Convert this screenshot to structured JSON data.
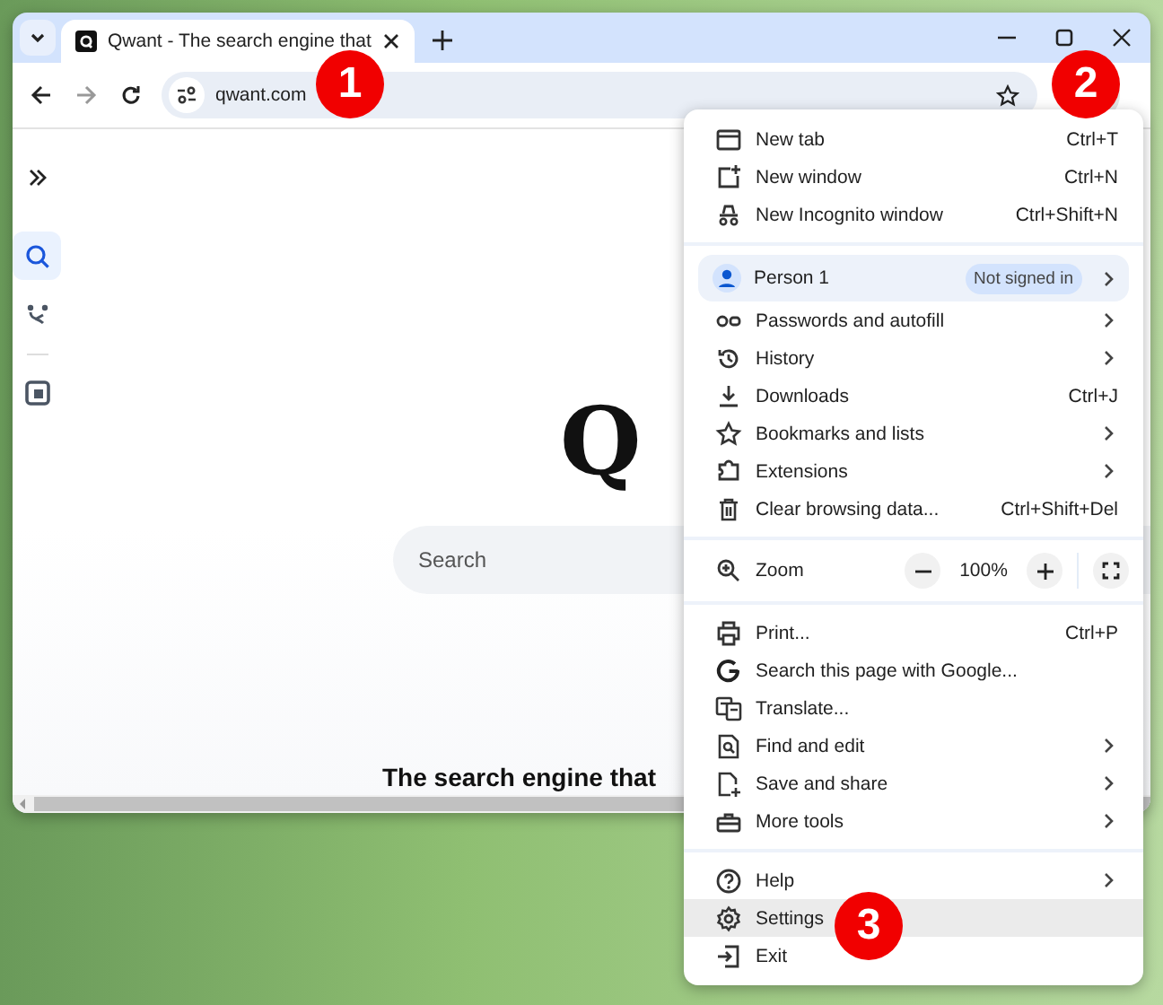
{
  "window": {
    "tabs": [
      {
        "title": "Qwant - The search engine that",
        "selected": true
      }
    ]
  },
  "toolbar": {
    "url": "qwant.com",
    "menu_open": true
  },
  "sidebar": {
    "items": [
      {
        "selected": true
      },
      {
        "selected": false
      },
      {
        "selected": false
      }
    ]
  },
  "page": {
    "logo": "Q",
    "search": {
      "placeholder": "Search"
    },
    "tagline": "The search engine that"
  },
  "menu": {
    "groups": [
      [
        {
          "kind": "item",
          "label": "New tab",
          "shortcut": "Ctrl+T",
          "submenu": false,
          "highlighted": false
        },
        {
          "kind": "item",
          "label": "New window",
          "shortcut": "Ctrl+N",
          "submenu": false,
          "highlighted": false
        },
        {
          "kind": "item",
          "label": "New Incognito window",
          "shortcut": "Ctrl+Shift+N",
          "submenu": false,
          "highlighted": false
        }
      ],
      [
        {
          "kind": "profile",
          "label": "Person 1",
          "status": "Not signed in",
          "submenu": true,
          "highlighted": false
        },
        {
          "kind": "item",
          "label": "Passwords and autofill",
          "submenu": true,
          "highlighted": false
        },
        {
          "kind": "item",
          "label": "History",
          "submenu": true,
          "highlighted": false
        },
        {
          "kind": "item",
          "label": "Downloads",
          "shortcut": "Ctrl+J",
          "submenu": false,
          "highlighted": false
        },
        {
          "kind": "item",
          "label": "Bookmarks and lists",
          "submenu": true,
          "highlighted": false
        },
        {
          "kind": "item",
          "label": "Extensions",
          "submenu": true,
          "highlighted": false
        },
        {
          "kind": "item",
          "label": "Clear browsing data...",
          "shortcut": "Ctrl+Shift+Del",
          "submenu": false,
          "highlighted": false
        }
      ],
      [
        {
          "kind": "zoom",
          "label": "Zoom",
          "value": "100%"
        }
      ],
      [
        {
          "kind": "item",
          "label": "Print...",
          "shortcut": "Ctrl+P",
          "submenu": false,
          "highlighted": false
        },
        {
          "kind": "item",
          "label": "Search this page with Google...",
          "submenu": false,
          "highlighted": false
        },
        {
          "kind": "item",
          "label": "Translate...",
          "submenu": false,
          "highlighted": false
        },
        {
          "kind": "item",
          "label": "Find and edit",
          "submenu": true,
          "highlighted": false
        },
        {
          "kind": "item",
          "label": "Save and share",
          "submenu": true,
          "highlighted": false
        },
        {
          "kind": "item",
          "label": "More tools",
          "submenu": true,
          "highlighted": false
        }
      ],
      [
        {
          "kind": "item",
          "label": "Help",
          "submenu": true,
          "highlighted": false
        },
        {
          "kind": "item",
          "label": "Settings",
          "submenu": false,
          "highlighted": true
        },
        {
          "kind": "item",
          "label": "Exit",
          "submenu": false,
          "highlighted": false
        }
      ]
    ]
  },
  "callouts": [
    "1",
    "2",
    "3"
  ]
}
